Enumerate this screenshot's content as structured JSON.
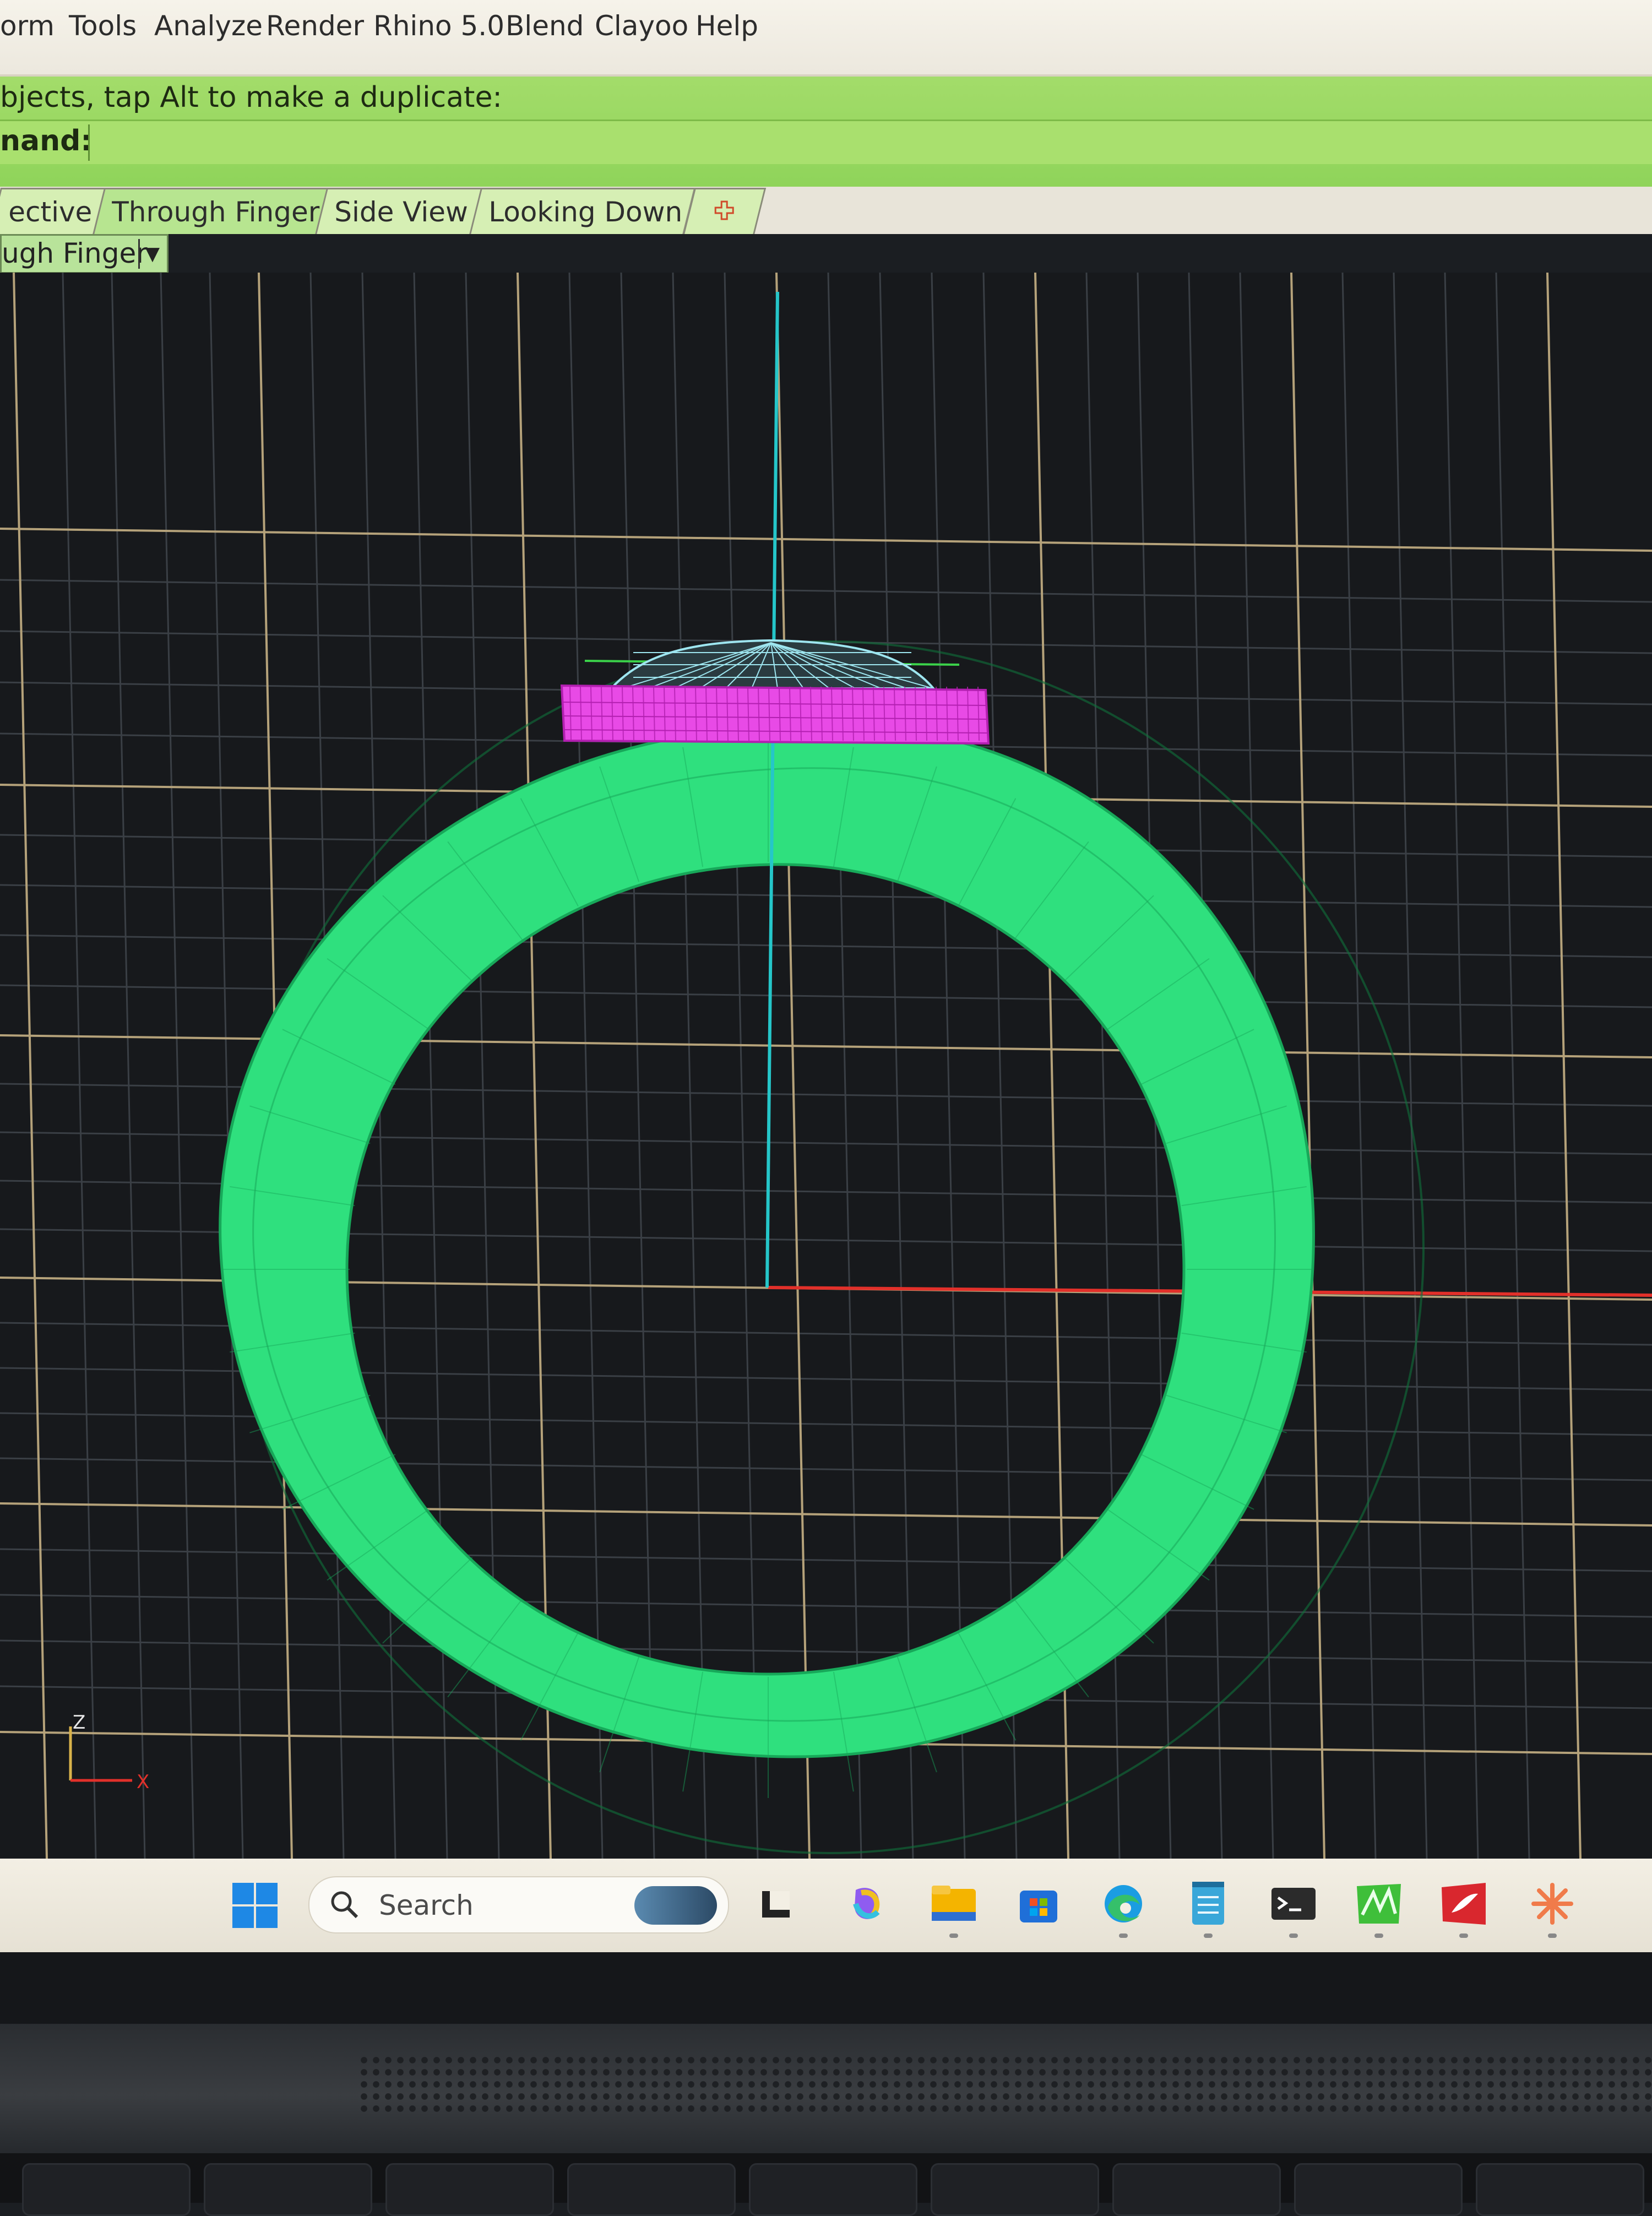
{
  "menu": {
    "items": [
      "orm",
      "Tools",
      "Analyze",
      "Render",
      "Rhino 5.0",
      "Blend",
      "Clayoo",
      "Help"
    ]
  },
  "command": {
    "prompt": "bjects, tap Alt to make a duplicate:",
    "label": "nand:"
  },
  "tabs": [
    {
      "label": "ective",
      "active": false
    },
    {
      "label": "Through Finger",
      "active": true
    },
    {
      "label": "Side View",
      "active": false
    },
    {
      "label": "Looking Down",
      "active": false
    }
  ],
  "add_tab_icon": "plus-icon",
  "viewport": {
    "title": "ugh Finger",
    "dropdown_icon": "chevron-down-icon",
    "axis_labels": {
      "z": "Z",
      "x": "X"
    },
    "colors": {
      "background": "#17191c",
      "grid_minor": "#3a3f45",
      "grid_major": "#b5a27a",
      "axis_z": "#25c6c9",
      "axis_x": "#e2302a",
      "ring": "#2fe07e",
      "ring_edge": "#18a85a",
      "setting": "#e84ae6",
      "gem": "#9ee6f0"
    }
  },
  "taskbar": {
    "search_placeholder": "Search",
    "icons": [
      "windows-start-icon",
      "search-icon",
      "news-widget-icon",
      "app-l-icon",
      "copilot-icon",
      "file-explorer-icon",
      "store-icon",
      "edge-icon",
      "notepad-icon",
      "terminal-icon",
      "rhino-green-icon",
      "pdf-red-icon",
      "spark-orange-icon"
    ]
  }
}
